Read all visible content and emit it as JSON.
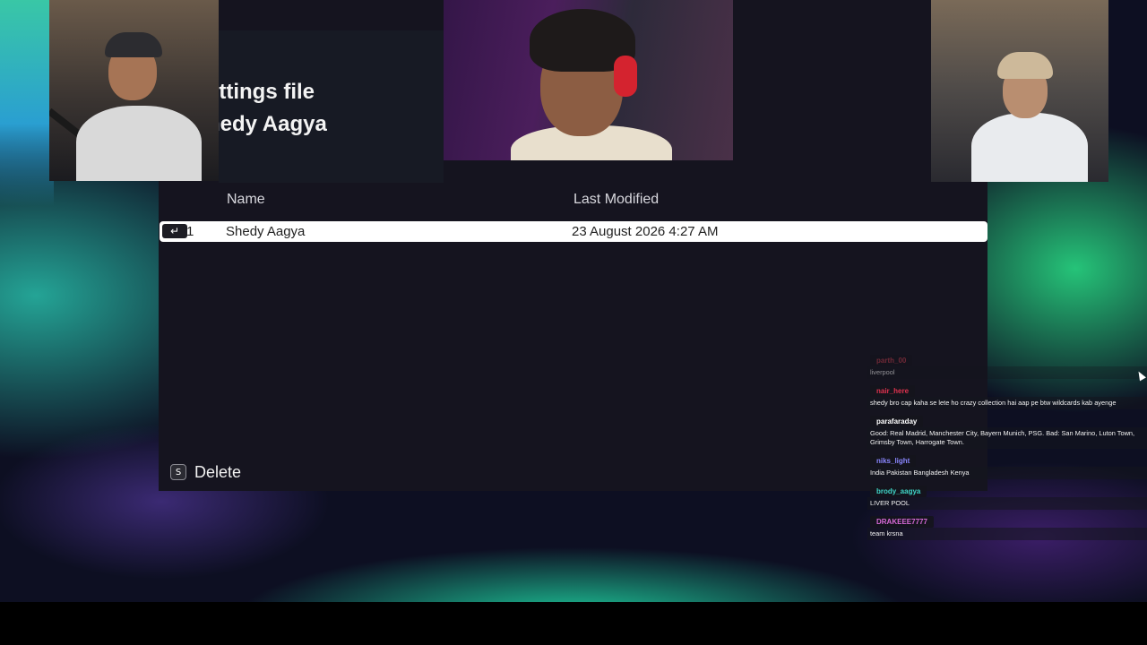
{
  "app": {
    "title_line_1": "ettings file",
    "title_line_2": "hedy Aagya"
  },
  "table": {
    "columns": [
      "Name",
      "Last Modified"
    ],
    "rows": [
      {
        "index": "1",
        "name": "Shedy Aagya",
        "last_modified": "23 August 2026 4:27 AM",
        "selected": true
      }
    ]
  },
  "row_action_icon": "enter-key-icon",
  "footer": {
    "delete_key": "S",
    "delete_label": "Delete"
  },
  "webcams": [
    {
      "id": "cam-left",
      "description_icon": "person-cap-icon"
    },
    {
      "id": "cam-center",
      "description_icon": "person-headphones-icon"
    },
    {
      "id": "cam-right",
      "description_icon": "person-icon"
    }
  ],
  "chat": {
    "messages": [
      {
        "user": "parth_00",
        "user_color": "#b8394a",
        "text": "liverpool"
      },
      {
        "user": "nair_here",
        "user_color": "#e0324f",
        "text": "shedy bro cap kaha se lete ho crazy collection hai aap pe btw wildcards kab ayenge"
      },
      {
        "user": "parafaraday",
        "user_color": "#ffffff",
        "text": "Good: Real Madrid, Manchester City, Bayern Munich, PSG. Bad: San Marino, Luton Town, Grimsby Town, Harrogate Town."
      },
      {
        "user": "niks_light",
        "user_color": "#8a86ff",
        "text": "India Pakistan Bangladesh Kenya"
      },
      {
        "user": "brody_aagya",
        "user_color": "#3fd6c8",
        "text": "LIVER POOL"
      },
      {
        "user": "DRAKEEE7777",
        "user_color": "#d86ad8",
        "text": "team krsna"
      }
    ]
  },
  "colors": {
    "window_bg": "#15141f",
    "row_selected_bg": "#ffffff",
    "accent_teal": "#2fd0a5"
  }
}
